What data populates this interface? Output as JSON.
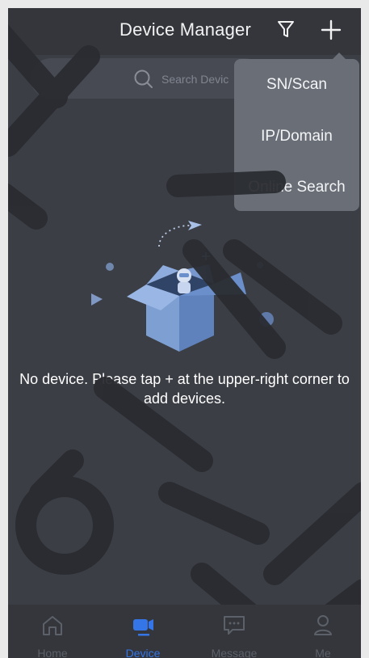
{
  "header": {
    "title": "Device Manager"
  },
  "search": {
    "placeholder": "Search Devic"
  },
  "add_menu": {
    "items": [
      "SN/Scan",
      "IP/Domain",
      "Online Search"
    ]
  },
  "empty_state": {
    "message_line1": "No device. Please tap + at the upper-right corner to",
    "message_line2": "add devices."
  },
  "bottom_nav": {
    "items": [
      {
        "label": "Home",
        "icon": "home-icon",
        "active": false
      },
      {
        "label": "Device",
        "icon": "camera-icon",
        "active": true
      },
      {
        "label": "Message",
        "icon": "message-icon",
        "active": false
      },
      {
        "label": "Me",
        "icon": "person-icon",
        "active": false
      }
    ]
  },
  "colors": {
    "accent": "#3476e8",
    "background": "#3b3e45",
    "menu": "#6a6f77"
  }
}
